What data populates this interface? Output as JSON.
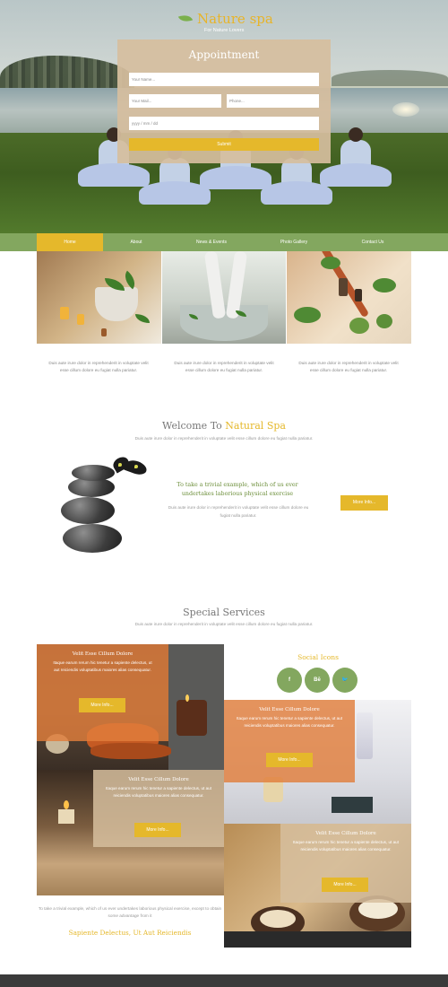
{
  "brand": {
    "name": "Nature spa",
    "tagline": "For Nature Lovers"
  },
  "appointment": {
    "title": "Appointment",
    "name_placeholder": "Your Name...",
    "mail_placeholder": "Your Mail...",
    "phone_placeholder": "Phone...",
    "date_placeholder": "yyyy / mm / dd",
    "submit_label": "Submit"
  },
  "nav": {
    "items": [
      "Home",
      "About",
      "News & Events",
      "Photo Gallery",
      "Contact Us"
    ],
    "active": "Home"
  },
  "gallery_captions": [
    "Duis aute irure dolor in reprehenderit in voluptate velit esse cillum dolore eu fugiat nulla pariatur.",
    "Duis aute irure dolor in reprehenderit in voluptate velit esse cillum dolore eu fugiat nulla pariatur.",
    "Duis aute irure dolor in reprehenderit in voluptate velit esse cillum dolore eu fugiat nulla pariatur."
  ],
  "welcome": {
    "title_plain": "Welcome To ",
    "title_highlight": "Natural Spa",
    "subtitle": "Duis aute irure dolor in reprehenderit in voluptate velit esse cillum dolore eu fugiat nulla pariatur.",
    "heading": "To take a trivial example, which of us ever undertakes laborious physical exercise",
    "text": "Duis aute irure dolor in reprehenderit in voluptate velit esse cillum dolore eu fugiat nulla pariatur.",
    "more_label": "More Info..."
  },
  "services": {
    "title": "Special Services",
    "subtitle": "Duis aute irure dolor in reprehenderit in voluptate velit esse cillum dolore eu fugiat nulla pariatur.",
    "cards": [
      {
        "title": "Velit Esse Cillum Dolore",
        "text": "Itaque earum rerum hic tenetur a sapiente delectus, ut aut reiciendis voluptatibus maiores alias consequatur.",
        "more_label": "More Info..."
      },
      {
        "title": "Velit Esse Cillum Dolore",
        "text": "Itaque earum rerum hic tenetur a sapiente delectus, ut aut reiciendis voluptatibus maiores alias consequatur.",
        "more_label": "More Info..."
      },
      {
        "title": "Velit Esse Cillum Dolore",
        "text": "Itaque earum rerum hic tenetur a sapiente delectus, ut aut reiciendis voluptatibus maiores alias consequatur.",
        "more_label": "More Info..."
      },
      {
        "title": "Velit Esse Cillum Dolore",
        "text": "Itaque earum rerum hic tenetur a sapiente delectus, ut aut reiciendis voluptatibus maiores alias consequatur.",
        "more_label": "More Info..."
      }
    ],
    "bottom_text": "To take a trivial example, which of us ever undertakes laborious physical exercise, except to obtain some advantage from it",
    "bottom_title": "Sapiente Delectus, Ut Aut Reiciendis"
  },
  "social": {
    "title": "Social Icons",
    "icons": [
      {
        "name": "facebook-icon",
        "glyph": "f"
      },
      {
        "name": "behance-icon",
        "glyph": "Bē"
      },
      {
        "name": "twitter-icon",
        "glyph": "🐦"
      }
    ]
  },
  "colors": {
    "accent": "#e5b82b",
    "green": "#83a75f",
    "overlay_orange": "#e07e3c",
    "overlay_beige": "#d6be9e",
    "footer": "#3b3b3b"
  }
}
